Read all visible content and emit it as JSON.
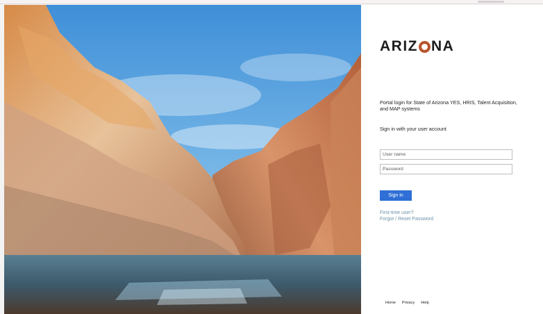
{
  "brand": {
    "logo_left": "ARIZ",
    "logo_right": "NA",
    "accent_color": "#b8542a"
  },
  "login": {
    "description": "Portal login for State of Arizona YES, HRIS, Talent Acquisition, and MAP systems",
    "subtitle": "Sign in with your user account",
    "username_placeholder": "User name",
    "password_placeholder": "Password",
    "sign_in_label": "Sign in",
    "button_color": "#2f6fd6"
  },
  "links": {
    "first_time": "First-time user?",
    "forgot": "Forgot / Reset Password"
  },
  "footer": {
    "home": "Home",
    "privacy": "Privacy",
    "help": "Help"
  }
}
